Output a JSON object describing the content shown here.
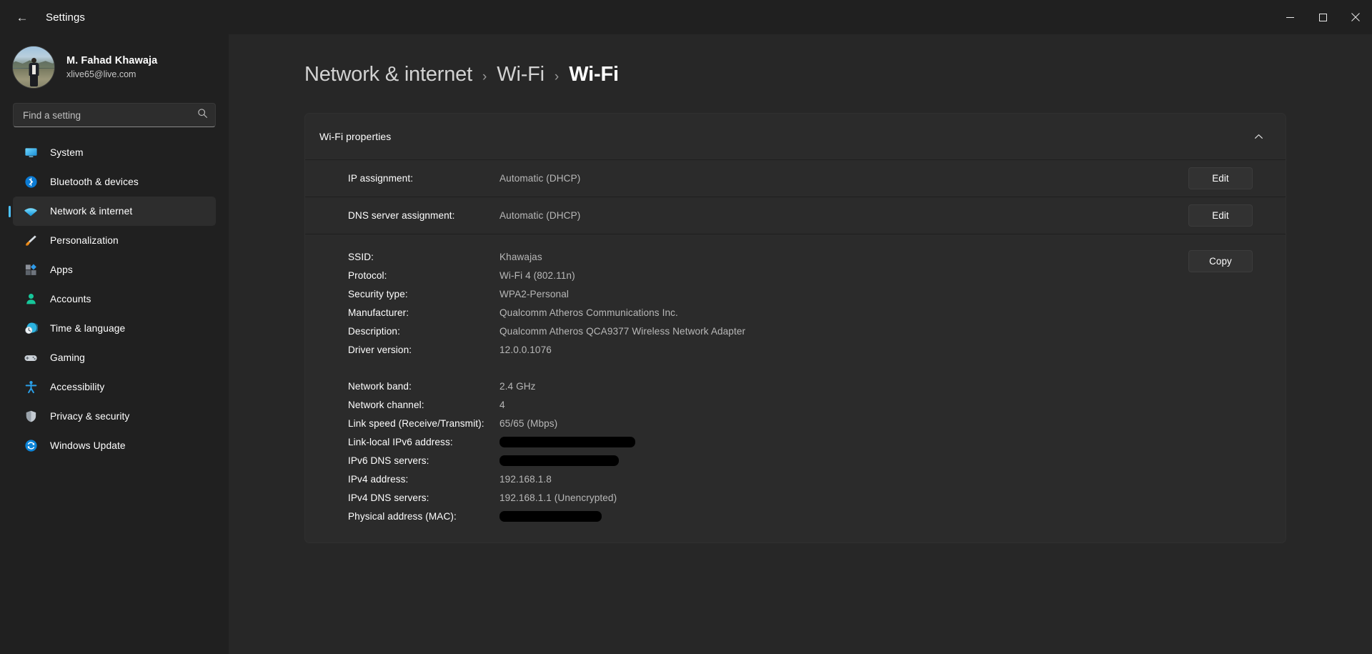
{
  "titlebar": {
    "back_label": "Back",
    "app_title": "Settings",
    "minimize_label": "Minimize",
    "maximize_label": "Maximize",
    "close_label": "Close"
  },
  "sidebar": {
    "profile": {
      "name": "M. Fahad Khawaja",
      "email": "xlive65@live.com"
    },
    "search": {
      "placeholder": "Find a setting",
      "value": ""
    },
    "items": [
      {
        "label": "System",
        "icon": "monitor-icon",
        "active": false
      },
      {
        "label": "Bluetooth & devices",
        "icon": "bluetooth-icon",
        "active": false
      },
      {
        "label": "Network & internet",
        "icon": "wifi-icon",
        "active": true
      },
      {
        "label": "Personalization",
        "icon": "paintbrush-icon",
        "active": false
      },
      {
        "label": "Apps",
        "icon": "apps-grid-icon",
        "active": false
      },
      {
        "label": "Accounts",
        "icon": "person-icon",
        "active": false
      },
      {
        "label": "Time & language",
        "icon": "clock-globe-icon",
        "active": false
      },
      {
        "label": "Gaming",
        "icon": "gamepad-icon",
        "active": false
      },
      {
        "label": "Accessibility",
        "icon": "accessibility-person-icon",
        "active": false
      },
      {
        "label": "Privacy & security",
        "icon": "shield-icon",
        "active": false
      },
      {
        "label": "Windows Update",
        "icon": "refresh-circle-icon",
        "active": false
      }
    ]
  },
  "breadcrumb": {
    "parts": [
      "Network & internet",
      "Wi-Fi",
      "Wi-Fi"
    ],
    "separator": "›"
  },
  "card": {
    "title": "Wi-Fi properties",
    "expanded": true,
    "rows": [
      {
        "label": "IP assignment:",
        "value": "Automatic (DHCP)",
        "action": "Edit"
      },
      {
        "label": "DNS server assignment:",
        "value": "Automatic (DHCP)",
        "action": "Edit"
      }
    ],
    "copy_label": "Copy",
    "details_group_1": [
      {
        "label": "SSID:",
        "value": "Khawajas"
      },
      {
        "label": "Protocol:",
        "value": "Wi-Fi 4 (802.11n)"
      },
      {
        "label": "Security type:",
        "value": "WPA2-Personal"
      },
      {
        "label": "Manufacturer:",
        "value": "Qualcomm Atheros Communications Inc."
      },
      {
        "label": "Description:",
        "value": "Qualcomm Atheros QCA9377 Wireless Network Adapter"
      },
      {
        "label": "Driver version:",
        "value": "12.0.0.1076"
      }
    ],
    "details_group_2": [
      {
        "label": "Network band:",
        "value": "2.4 GHz",
        "redacted": false
      },
      {
        "label": "Network channel:",
        "value": "4",
        "redacted": false
      },
      {
        "label": "Link speed (Receive/Transmit):",
        "value": "65/65 (Mbps)",
        "redacted": false
      },
      {
        "label": "Link-local IPv6 address:",
        "value": "",
        "redacted": true,
        "redact_width": 190
      },
      {
        "label": "IPv6 DNS servers:",
        "value": "",
        "redacted": true,
        "redact_width": 167
      },
      {
        "label": "IPv4 address:",
        "value": "192.168.1.8",
        "redacted": false
      },
      {
        "label": "IPv4 DNS servers:",
        "value": "192.168.1.1 (Unencrypted)",
        "redacted": false
      },
      {
        "label": "Physical address (MAC):",
        "value": "",
        "redacted": true,
        "redact_width": 143
      }
    ]
  },
  "colors": {
    "accent": "#4cc2ff",
    "window_bg": "#202020",
    "content_bg": "#272727",
    "card_bg": "#2b2b2b",
    "close_hover": "#c42b1c"
  }
}
